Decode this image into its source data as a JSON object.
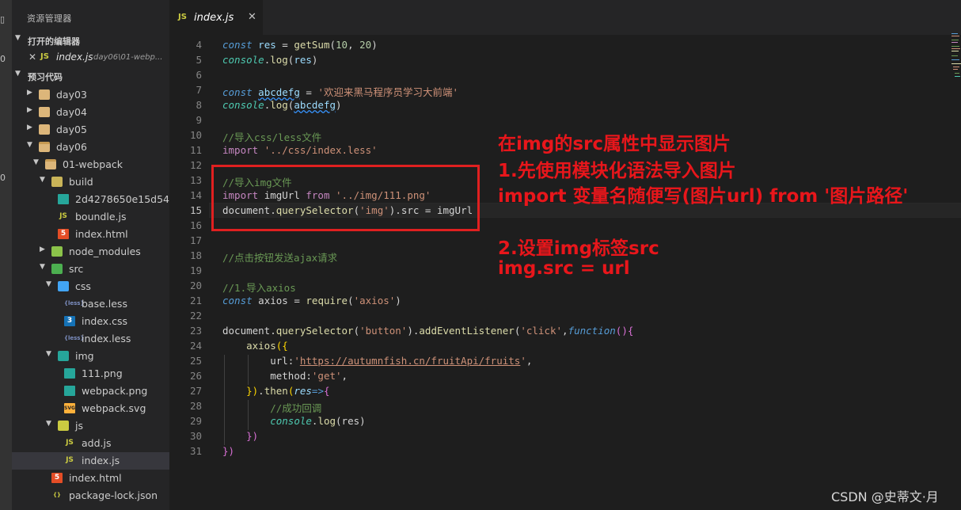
{
  "activity": {
    "glyphs": [
      "▯",
      "0",
      "0"
    ]
  },
  "sidebar": {
    "title": "资源管理器",
    "open_editors_label": "打开的编辑器",
    "open_editor": {
      "close": "✕",
      "icon": "JS",
      "name": "index.js",
      "path": "day06\\01-webp..."
    },
    "project_label": "预习代码",
    "tree": [
      {
        "name": "day03",
        "icon": "folder-icon"
      },
      {
        "name": "day04",
        "icon": "folder-icon"
      },
      {
        "name": "day05",
        "icon": "folder-icon"
      },
      {
        "name": "day06",
        "icon": "folder-open-icon"
      },
      {
        "name": "01-webpack",
        "icon": "folder-open-icon"
      },
      {
        "name": "build",
        "icon": "folder-build-icon"
      },
      {
        "name": "2d4278650e15d54...",
        "icon": "image-file-icon"
      },
      {
        "name": "boundle.js",
        "icon": "js-file-icon"
      },
      {
        "name": "index.html",
        "icon": "html-file-icon"
      },
      {
        "name": "node_modules",
        "icon": "folder-node-icon"
      },
      {
        "name": "src",
        "icon": "folder-src-icon"
      },
      {
        "name": "css",
        "icon": "folder-css-icon"
      },
      {
        "name": "base.less",
        "icon": "less-file-icon"
      },
      {
        "name": "index.css",
        "icon": "css-file-icon"
      },
      {
        "name": "index.less",
        "icon": "less-file-icon"
      },
      {
        "name": "img",
        "icon": "folder-img-icon"
      },
      {
        "name": "111.png",
        "icon": "image-file-icon"
      },
      {
        "name": "webpack.png",
        "icon": "image-file-icon"
      },
      {
        "name": "webpack.svg",
        "icon": "svg-file-icon"
      },
      {
        "name": "js",
        "icon": "folder-js-icon"
      },
      {
        "name": "add.js",
        "icon": "js-file-icon"
      },
      {
        "name": "index.js",
        "icon": "js-file-icon"
      },
      {
        "name": "index.html",
        "icon": "html-file-icon"
      },
      {
        "name": "package-lock.json",
        "icon": "json-file-icon"
      }
    ],
    "icon_glyphs": {
      "js": "JS",
      "html": "5",
      "css": "3",
      "less": "{less}",
      "svg": "SVG",
      "json": "{}"
    }
  },
  "tabs": [
    {
      "icon": "JS",
      "label": "index.js",
      "close": "✕"
    }
  ],
  "editor": {
    "line_numbers": [
      "4",
      "5",
      "6",
      "7",
      "8",
      "9",
      "10",
      "11",
      "12",
      "13",
      "14",
      "15",
      "16",
      "17",
      "18",
      "19",
      "20",
      "21",
      "22",
      "23",
      "24",
      "25",
      "26",
      "27",
      "28",
      "29",
      "30",
      "31"
    ],
    "active_line": "15",
    "code": {
      "l4": {
        "kw": "const",
        "v": "res",
        "eq": " = ",
        "fn": "getSum",
        "p1": "(",
        "n1": "10",
        "c": ", ",
        "n2": "20",
        "p2": ")"
      },
      "l5": {
        "obj": "console",
        "dot": ".",
        "fn": "log",
        "p1": "(",
        "v": "res",
        "p2": ")"
      },
      "l7": {
        "kw": "const",
        "v": "abcdefg",
        "eq": " = ",
        "str": "'欢迎来黑马程序员学习大前端'"
      },
      "l8": {
        "obj": "console",
        "dot": ".",
        "fn": "log",
        "p1": "(",
        "v": "abcdefg",
        "p2": ")"
      },
      "l10": "//导入css/less文件",
      "l11": {
        "kw": "import",
        "str": "'../css/index.less'"
      },
      "l13": "//导入img文件",
      "l14": {
        "kw": "import",
        "v": "imgUrl",
        "from": "from",
        "str": "'../img/111.png'"
      },
      "l15": {
        "obj": "document",
        "dot": ".",
        "fn": "querySelector",
        "p1": "(",
        "str": "'img'",
        "p2": ")",
        "rest": ".src = ",
        "v": "imgUrl"
      },
      "l18": "//点击按钮发送ajax请求",
      "l20": "//1.导入axios",
      "l21": {
        "kw": "const",
        "v": "axios",
        "eq": " = ",
        "fn": "require",
        "p1": "(",
        "str": "'axios'",
        "p2": ")"
      },
      "l23": {
        "obj": "document",
        "dot": ".",
        "fn": "querySelector",
        "p1": "(",
        "str": "'button'",
        "p2": ")",
        "dot2": ".",
        "fn2": "addEventListener",
        "p3": "(",
        "str2": "'click'",
        "c": ",",
        "kw": "function",
        "p4": "(){"
      },
      "l24": {
        "fn": "axios",
        "p": "({"
      },
      "l25": {
        "key": "url",
        "col": ":",
        "q1": "'",
        "url": "https://autumnfish.cn/fruitApi/fruits",
        "q2": "'",
        "c": ","
      },
      "l26": {
        "key": "method",
        "col": ":",
        "str": "'get'",
        "c": ","
      },
      "l27": {
        "p1": "})",
        "dot": ".",
        "fn": "then",
        "p2": "(",
        "param": "res",
        "arrow": "=>",
        "p3": "{"
      },
      "l28": "//成功回调",
      "l29": {
        "obj": "console",
        "dot": ".",
        "fn": "log",
        "p1": "(",
        "v": "res",
        "p2": ")"
      },
      "l30": "})",
      "l31": "})"
    }
  },
  "annotations": [
    "在img的src属性中显示图片",
    "1.先使用模块化语法导入图片",
    "import  变量名随便写(图片url) from '图片路径'",
    "2.设置img标签src",
    "img.src = url"
  ],
  "watermark": "CSDN @史蒂文·月",
  "colors": {
    "annotation_red": "#e8161b",
    "box_red": "#e02020",
    "editor_bg": "#1e1e1e",
    "sidebar_bg": "#252526"
  }
}
